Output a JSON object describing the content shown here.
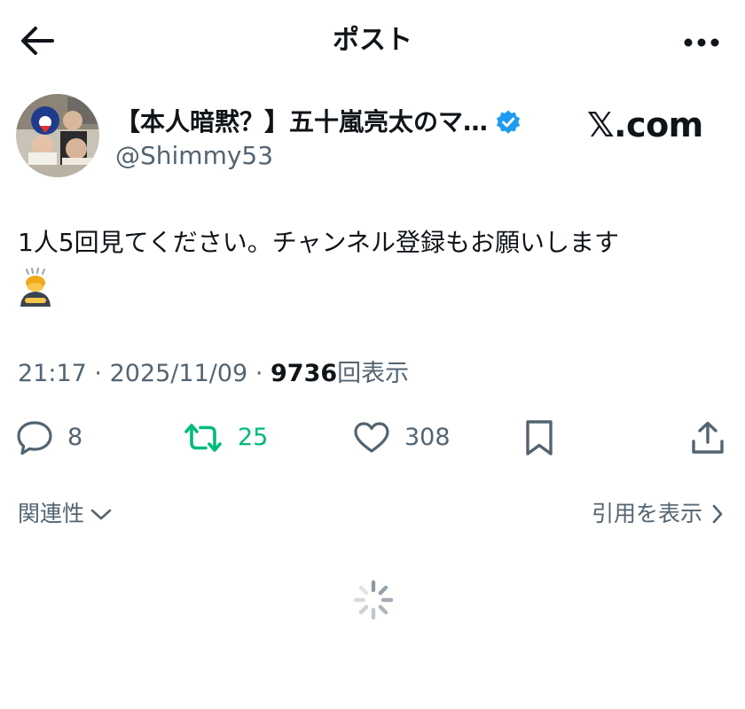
{
  "header": {
    "title": "ポスト",
    "back_icon": "arrow-left-icon",
    "more_icon": "more-horizontal-icon"
  },
  "author": {
    "display_name": "【本人暗黙？】五十嵐亮太のマ…",
    "handle": "@Shimmy53",
    "verified": true,
    "verified_color": "#1d9bf0"
  },
  "brand": "𝕏.com",
  "tweet": {
    "text": "1人5回見てください。チャンネル登録もお願いします",
    "emoji": "🙇‍♂️"
  },
  "meta": {
    "time": "21:17",
    "date": "2025/11/09",
    "views_count": "9736",
    "views_label": "回表示",
    "separator": "·"
  },
  "actions": {
    "reply_count": "8",
    "retweet_count": "25",
    "like_count": "308"
  },
  "footer": {
    "related_label": "関連性",
    "quotes_label": "引用を表示"
  },
  "colors": {
    "text": "#0f1419",
    "secondary": "#536471",
    "retweet": "#00ba7c",
    "verified": "#1d9bf0"
  }
}
